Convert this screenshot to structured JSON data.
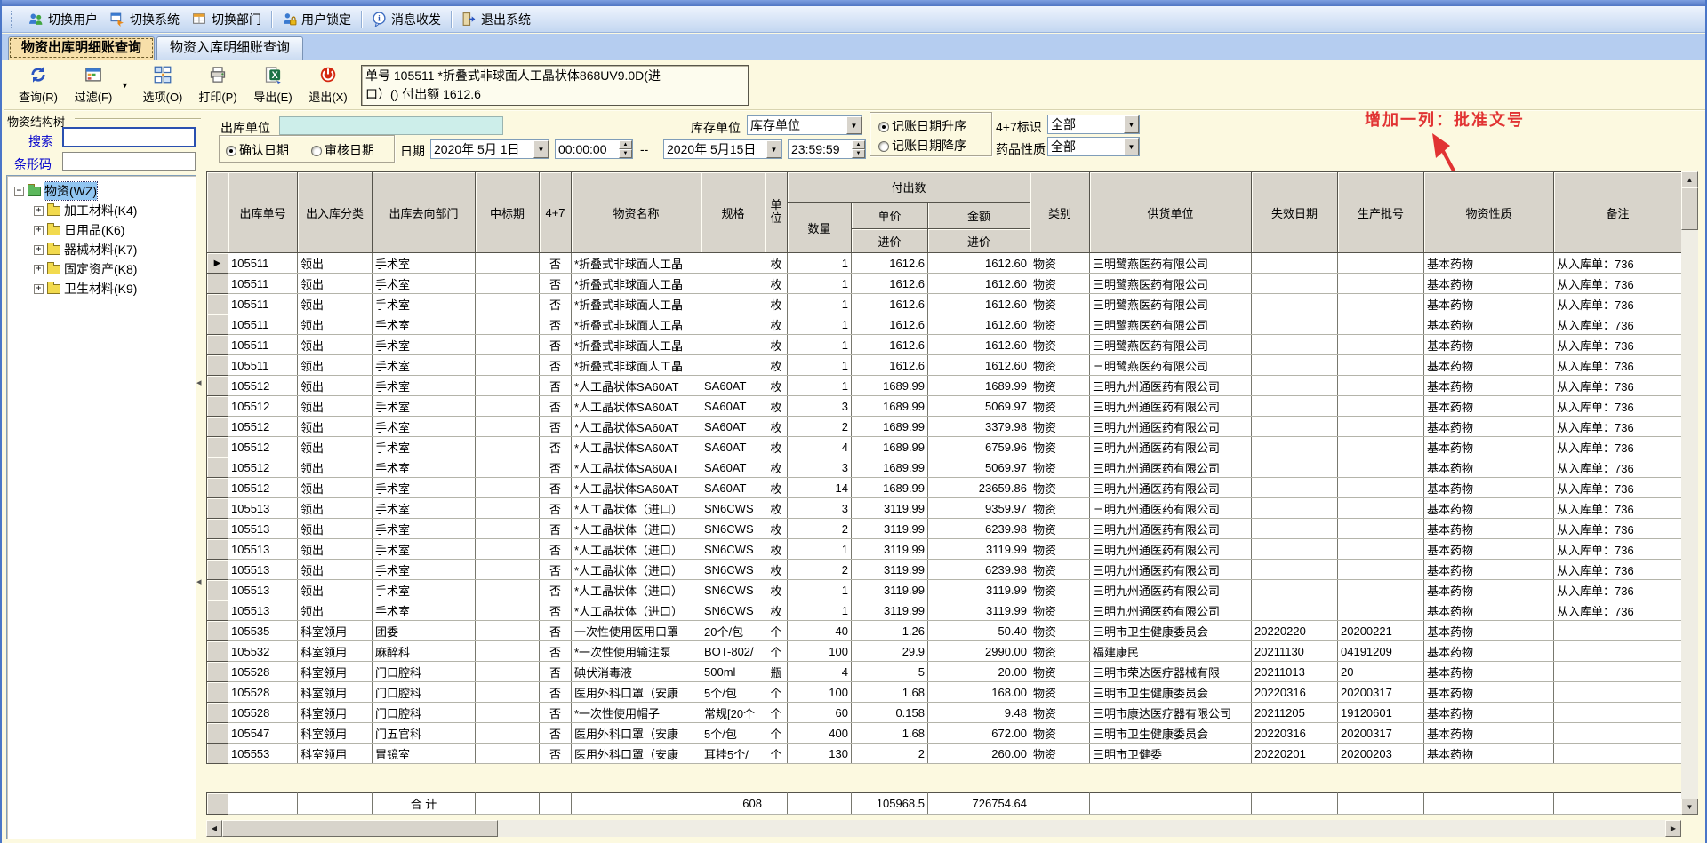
{
  "top_toolbar": {
    "items": [
      {
        "label": "切换用户",
        "icon": "switch-user"
      },
      {
        "label": "切换系统",
        "icon": "switch-system"
      },
      {
        "label": "切换部门",
        "icon": "switch-dept"
      },
      {
        "label": "用户锁定",
        "icon": "user-lock"
      },
      {
        "label": "消息收发",
        "icon": "messages"
      },
      {
        "label": "退出系统",
        "icon": "exit-system"
      }
    ]
  },
  "tabs": [
    {
      "label": "物资出库明细账查询",
      "active": true
    },
    {
      "label": "物资入库明细账查询",
      "active": false
    }
  ],
  "query_toolbar": {
    "buttons": [
      {
        "label": "查询(R)",
        "icon": "query"
      },
      {
        "label": "过滤(F)",
        "icon": "filter"
      },
      {
        "label": "选项(O)",
        "icon": "options"
      },
      {
        "label": "打印(P)",
        "icon": "print"
      },
      {
        "label": "导出(E)",
        "icon": "export-excel"
      },
      {
        "label": "退出(X)",
        "icon": "exit"
      }
    ],
    "filter_dropdown_glyph": "▼",
    "info": {
      "line1": "单号 105511  *折叠式非球面人工晶状体868UV9.0D(进",
      "line2": "口）() 付出额 1612.6"
    }
  },
  "sidebar": {
    "title": "物资结构树",
    "search_label": "搜索",
    "search_value": "",
    "barcode_label": "条形码",
    "barcode_value": "",
    "tree": {
      "root": "物资(WZ)",
      "children": [
        "加工材料(K4)",
        "日用品(K6)",
        "器械材料(K7)",
        "固定资产(K8)",
        "卫生材料(K9)"
      ]
    }
  },
  "filters": {
    "out_unit_label": "出库单位",
    "out_unit_value": "",
    "stock_unit_label": "库存单位",
    "stock_unit_value": "库存单位",
    "confirm_date_label": "确认日期",
    "audit_date_label": "审核日期",
    "date_label": "日期",
    "date_from": "2020年 5月 1日",
    "time_from": "00:00:00",
    "range_sep": "--",
    "date_to": "2020年 5月15日",
    "time_to": "23:59:59",
    "sort_asc_label": "记账日期升序",
    "sort_desc_label": "记账日期降序",
    "flag47_label": "4+7标识",
    "flag47_value": "全部",
    "drug_nature_label": "药品性质",
    "drug_nature_value": "全部"
  },
  "annotation": {
    "text": "增加一列：批准文号",
    "color": "#e13333"
  },
  "table": {
    "headers": {
      "id": "出库单号",
      "cat": "出入库分类",
      "dept": "出库去向部门",
      "bid": "中标期",
      "f47": "4+7",
      "name": "物资名称",
      "spec": "规格",
      "unit": "单位",
      "payout_group": "付出数",
      "qty": "数量",
      "price": "单价",
      "amount": "金额",
      "price_in": "进价",
      "amount_in": "进价",
      "type": "类别",
      "supplier": "供货单位",
      "expire": "失效日期",
      "batch": "生产批号",
      "nature": "物资性质",
      "remark": "备注"
    },
    "current_row": 0,
    "rows": [
      [
        "105511",
        "领出",
        "手术室",
        "",
        "否",
        "*折叠式非球面人工晶",
        "",
        "枚",
        "1",
        "1612.6",
        "1612.60",
        "物资",
        "三明鹭燕医药有限公司",
        "",
        "",
        "基本药物",
        "从入库单：736"
      ],
      [
        "105511",
        "领出",
        "手术室",
        "",
        "否",
        "*折叠式非球面人工晶",
        "",
        "枚",
        "1",
        "1612.6",
        "1612.60",
        "物资",
        "三明鹭燕医药有限公司",
        "",
        "",
        "基本药物",
        "从入库单：736"
      ],
      [
        "105511",
        "领出",
        "手术室",
        "",
        "否",
        "*折叠式非球面人工晶",
        "",
        "枚",
        "1",
        "1612.6",
        "1612.60",
        "物资",
        "三明鹭燕医药有限公司",
        "",
        "",
        "基本药物",
        "从入库单：736"
      ],
      [
        "105511",
        "领出",
        "手术室",
        "",
        "否",
        "*折叠式非球面人工晶",
        "",
        "枚",
        "1",
        "1612.6",
        "1612.60",
        "物资",
        "三明鹭燕医药有限公司",
        "",
        "",
        "基本药物",
        "从入库单：736"
      ],
      [
        "105511",
        "领出",
        "手术室",
        "",
        "否",
        "*折叠式非球面人工晶",
        "",
        "枚",
        "1",
        "1612.6",
        "1612.60",
        "物资",
        "三明鹭燕医药有限公司",
        "",
        "",
        "基本药物",
        "从入库单：736"
      ],
      [
        "105511",
        "领出",
        "手术室",
        "",
        "否",
        "*折叠式非球面人工晶",
        "",
        "枚",
        "1",
        "1612.6",
        "1612.60",
        "物资",
        "三明鹭燕医药有限公司",
        "",
        "",
        "基本药物",
        "从入库单：736"
      ],
      [
        "105512",
        "领出",
        "手术室",
        "",
        "否",
        "*人工晶状体SA60AT",
        "SA60AT",
        "枚",
        "1",
        "1689.99",
        "1689.99",
        "物资",
        "三明九州通医药有限公司",
        "",
        "",
        "基本药物",
        "从入库单：736"
      ],
      [
        "105512",
        "领出",
        "手术室",
        "",
        "否",
        "*人工晶状体SA60AT",
        "SA60AT",
        "枚",
        "3",
        "1689.99",
        "5069.97",
        "物资",
        "三明九州通医药有限公司",
        "",
        "",
        "基本药物",
        "从入库单：736"
      ],
      [
        "105512",
        "领出",
        "手术室",
        "",
        "否",
        "*人工晶状体SA60AT",
        "SA60AT",
        "枚",
        "2",
        "1689.99",
        "3379.98",
        "物资",
        "三明九州通医药有限公司",
        "",
        "",
        "基本药物",
        "从入库单：736"
      ],
      [
        "105512",
        "领出",
        "手术室",
        "",
        "否",
        "*人工晶状体SA60AT",
        "SA60AT",
        "枚",
        "4",
        "1689.99",
        "6759.96",
        "物资",
        "三明九州通医药有限公司",
        "",
        "",
        "基本药物",
        "从入库单：736"
      ],
      [
        "105512",
        "领出",
        "手术室",
        "",
        "否",
        "*人工晶状体SA60AT",
        "SA60AT",
        "枚",
        "3",
        "1689.99",
        "5069.97",
        "物资",
        "三明九州通医药有限公司",
        "",
        "",
        "基本药物",
        "从入库单：736"
      ],
      [
        "105512",
        "领出",
        "手术室",
        "",
        "否",
        "*人工晶状体SA60AT",
        "SA60AT",
        "枚",
        "14",
        "1689.99",
        "23659.86",
        "物资",
        "三明九州通医药有限公司",
        "",
        "",
        "基本药物",
        "从入库单：736"
      ],
      [
        "105513",
        "领出",
        "手术室",
        "",
        "否",
        "*人工晶状体（进口）",
        "SN6CWS",
        "枚",
        "3",
        "3119.99",
        "9359.97",
        "物资",
        "三明九州通医药有限公司",
        "",
        "",
        "基本药物",
        "从入库单：736"
      ],
      [
        "105513",
        "领出",
        "手术室",
        "",
        "否",
        "*人工晶状体（进口）",
        "SN6CWS",
        "枚",
        "2",
        "3119.99",
        "6239.98",
        "物资",
        "三明九州通医药有限公司",
        "",
        "",
        "基本药物",
        "从入库单：736"
      ],
      [
        "105513",
        "领出",
        "手术室",
        "",
        "否",
        "*人工晶状体（进口）",
        "SN6CWS",
        "枚",
        "1",
        "3119.99",
        "3119.99",
        "物资",
        "三明九州通医药有限公司",
        "",
        "",
        "基本药物",
        "从入库单：736"
      ],
      [
        "105513",
        "领出",
        "手术室",
        "",
        "否",
        "*人工晶状体（进口）",
        "SN6CWS",
        "枚",
        "2",
        "3119.99",
        "6239.98",
        "物资",
        "三明九州通医药有限公司",
        "",
        "",
        "基本药物",
        "从入库单：736"
      ],
      [
        "105513",
        "领出",
        "手术室",
        "",
        "否",
        "*人工晶状体（进口）",
        "SN6CWS",
        "枚",
        "1",
        "3119.99",
        "3119.99",
        "物资",
        "三明九州通医药有限公司",
        "",
        "",
        "基本药物",
        "从入库单：736"
      ],
      [
        "105513",
        "领出",
        "手术室",
        "",
        "否",
        "*人工晶状体（进口）",
        "SN6CWS",
        "枚",
        "1",
        "3119.99",
        "3119.99",
        "物资",
        "三明九州通医药有限公司",
        "",
        "",
        "基本药物",
        "从入库单：736"
      ],
      [
        "105535",
        "科室领用",
        "团委",
        "",
        "否",
        "一次性使用医用口罩",
        "20个/包",
        "个",
        "40",
        "1.26",
        "50.40",
        "物资",
        "三明市卫生健康委员会",
        "20220220",
        "20200221",
        "基本药物",
        ""
      ],
      [
        "105532",
        "科室领用",
        "麻醉科",
        "",
        "否",
        "*一次性使用输注泵",
        "BOT-802/",
        "个",
        "100",
        "29.9",
        "2990.00",
        "物资",
        "福建康民",
        "20211130",
        "04191209",
        "基本药物",
        ""
      ],
      [
        "105528",
        "科室领用",
        "门口腔科",
        "",
        "否",
        "碘伏消毒液",
        "500ml",
        "瓶",
        "4",
        "5",
        "20.00",
        "物资",
        "三明市荣达医疗器械有限",
        "20211013",
        "20",
        "基本药物",
        ""
      ],
      [
        "105528",
        "科室领用",
        "门口腔科",
        "",
        "否",
        "医用外科口罩（安康",
        "5个/包",
        "个",
        "100",
        "1.68",
        "168.00",
        "物资",
        "三明市卫生健康委员会",
        "20220316",
        "20200317",
        "基本药物",
        ""
      ],
      [
        "105528",
        "科室领用",
        "门口腔科",
        "",
        "否",
        "*一次性使用帽子",
        "常规[20个",
        "个",
        "60",
        "0.158",
        "9.48",
        "物资",
        "三明市康达医疗器有限公司",
        "20211205",
        "19120601",
        "基本药物",
        ""
      ],
      [
        "105547",
        "科室领用",
        "门五官科",
        "",
        "否",
        "医用外科口罩（安康",
        "5个/包",
        "个",
        "400",
        "1.68",
        "672.00",
        "物资",
        "三明市卫生健康委员会",
        "20220316",
        "20200317",
        "基本药物",
        ""
      ],
      [
        "105553",
        "科室领用",
        "胃镜室",
        "",
        "否",
        "医用外科口罩（安康",
        "耳挂5个/",
        "个",
        "130",
        "2",
        "260.00",
        "物资",
        "三明市卫健委",
        "20220201",
        "20200203",
        "基本药物",
        ""
      ]
    ],
    "totals": {
      "label": "合 计",
      "qty_total": "608",
      "price_total": "105968.5",
      "amount_total": "726754.64"
    }
  }
}
